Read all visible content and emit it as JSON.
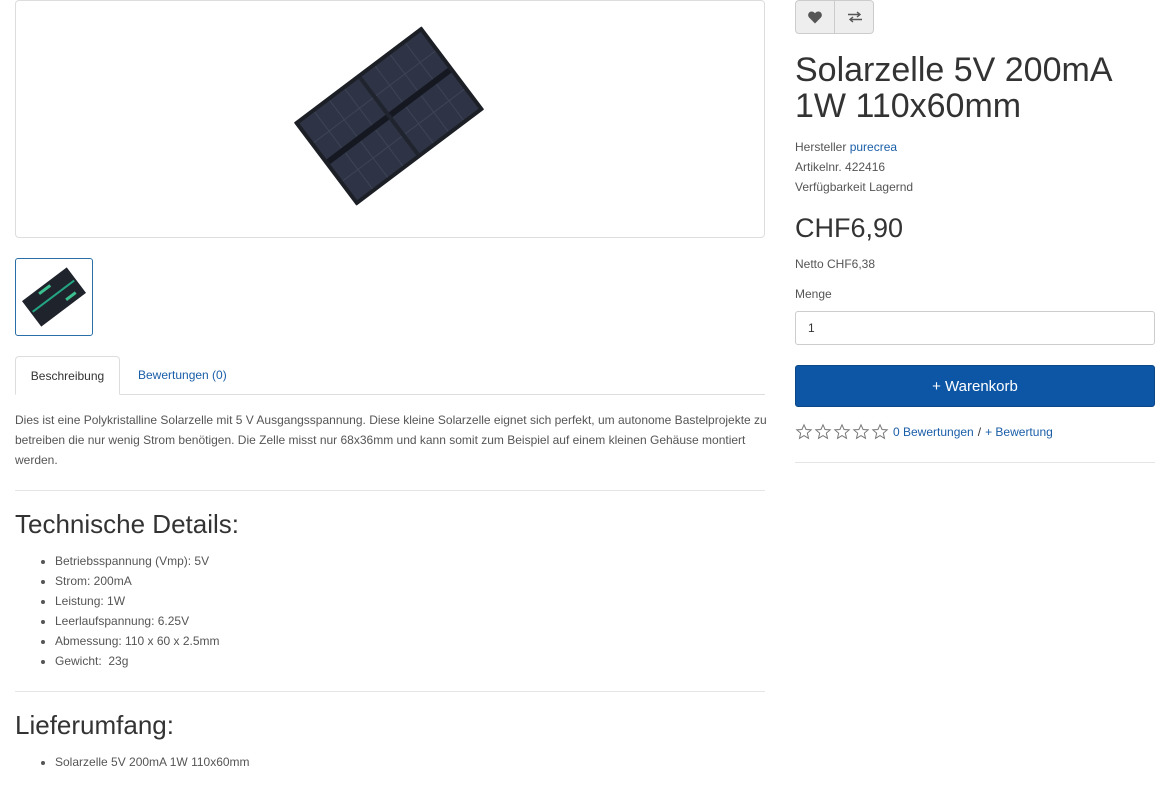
{
  "product": {
    "title": "Solarzelle 5V 200mA 1W 110x60mm",
    "meta": {
      "manufacturer_label": "Hersteller",
      "manufacturer_value": "purecrea",
      "article_label": "Artikelnr.",
      "article_value": "422416",
      "availability_label": "Verfügbarkeit",
      "availability_value": "Lagernd"
    },
    "price": "CHF6,90",
    "netto": "Netto CHF6,38",
    "quantity_label": "Menge",
    "quantity_value": "1",
    "cart_button": "+ Warenkorb",
    "rating": {
      "stars": 0,
      "reviews_link": "0 Bewertungen",
      "separator": "/",
      "add_review_link": "+ Bewertung"
    }
  },
  "actions": {
    "wishlist_icon": "heart-icon",
    "compare_icon": "compare-arrows-icon"
  },
  "tabs": [
    {
      "label": "Beschreibung",
      "active": true
    },
    {
      "label": "Bewertungen (0)",
      "active": false
    }
  ],
  "description": "Dies ist eine Polykristalline Solarzelle mit 5 V Ausgangsspannung. Diese kleine Solarzelle eignet sich perfekt, um autonome Bastelprojekte zu betreiben die nur wenig Strom benötigen. Die Zelle misst nur 68x36mm und kann somit zum Beispiel auf einem kleinen Gehäuse montiert werden.",
  "tech_details": {
    "heading": "Technische Details:",
    "items": [
      "Betriebsspannung (Vmp): 5V",
      "Strom: 200mA",
      "Leistung: 1W",
      "Leerlaufspannung: 6.25V",
      "Abmessung: 110 x 60 x 2.5mm",
      "Gewicht:  23g"
    ]
  },
  "delivery": {
    "heading": "Lieferumfang:",
    "items": [
      "Solarzelle 5V 200mA 1W 110x60mm"
    ]
  },
  "colors": {
    "link": "#1a5ea8",
    "primary_button": "#0d56a6",
    "thumb_border": "#2a6fa8"
  }
}
